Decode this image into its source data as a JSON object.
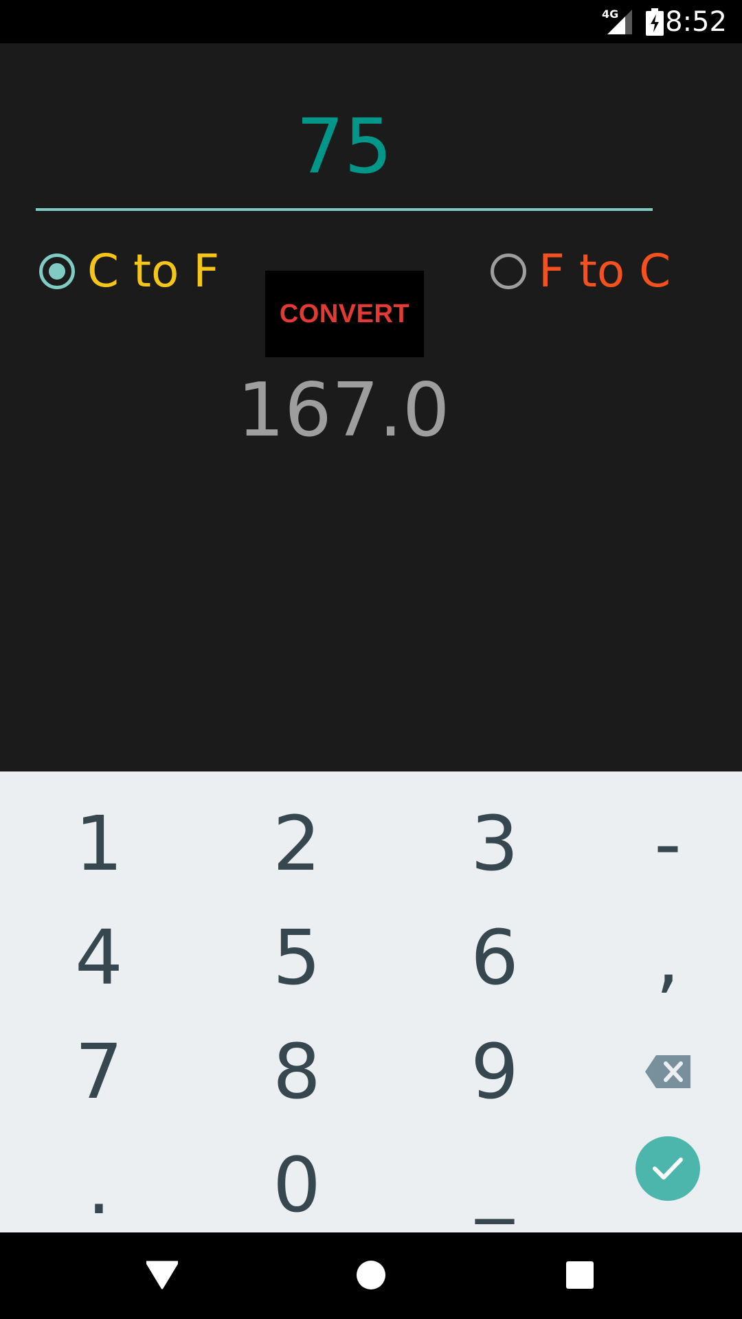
{
  "status_bar": {
    "network_label": "4G",
    "time": "8:52"
  },
  "converter": {
    "input_value": "75",
    "options": [
      {
        "label": "C to F",
        "checked": true,
        "color": "#f5c518"
      },
      {
        "label": "F to C",
        "checked": false,
        "color": "#f4511e"
      }
    ],
    "convert_label": "CONVERT",
    "result": "167.0",
    "accent_color": "#009688"
  },
  "keyboard": {
    "keys": [
      "1",
      "2",
      "3",
      "-",
      "4",
      "5",
      "6",
      ",",
      "7",
      "8",
      "9",
      ".",
      "0",
      "_"
    ],
    "backspace_icon": "backspace-icon",
    "done_icon": "check-icon"
  },
  "nav_bar": {
    "icons": [
      "back-icon",
      "home-icon",
      "recents-icon"
    ]
  }
}
